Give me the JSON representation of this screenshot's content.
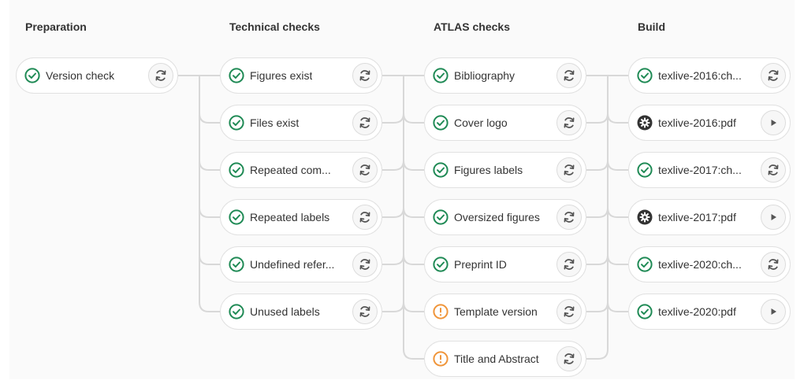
{
  "colors": {
    "success": "#1f8a55",
    "warning": "#f0953a",
    "manual": "#333333"
  },
  "stages": [
    {
      "title": "Preparation",
      "jobs": [
        {
          "name": "Version check",
          "status": "success",
          "action": "retry"
        }
      ]
    },
    {
      "title": "Technical checks",
      "jobs": [
        {
          "name": "Figures exist",
          "status": "success",
          "action": "retry"
        },
        {
          "name": "Files exist",
          "status": "success",
          "action": "retry"
        },
        {
          "name": "Repeated com...",
          "status": "success",
          "action": "retry"
        },
        {
          "name": "Repeated labels",
          "status": "success",
          "action": "retry"
        },
        {
          "name": "Undefined refer...",
          "status": "success",
          "action": "retry"
        },
        {
          "name": "Unused labels",
          "status": "success",
          "action": "retry"
        }
      ]
    },
    {
      "title": "ATLAS checks",
      "jobs": [
        {
          "name": "Bibliography",
          "status": "success",
          "action": "retry"
        },
        {
          "name": "Cover logo",
          "status": "success",
          "action": "retry"
        },
        {
          "name": "Figures labels",
          "status": "success",
          "action": "retry"
        },
        {
          "name": "Oversized figures",
          "status": "success",
          "action": "retry"
        },
        {
          "name": "Preprint ID",
          "status": "success",
          "action": "retry"
        },
        {
          "name": "Template version",
          "status": "warning",
          "action": "retry"
        },
        {
          "name": "Title and Abstract",
          "status": "warning",
          "action": "retry"
        }
      ]
    },
    {
      "title": "Build",
      "jobs": [
        {
          "name": "texlive-2016:ch...",
          "status": "success",
          "action": "retry"
        },
        {
          "name": "texlive-2016:pdf",
          "status": "manual",
          "action": "play"
        },
        {
          "name": "texlive-2017:ch...",
          "status": "success",
          "action": "retry"
        },
        {
          "name": "texlive-2017:pdf",
          "status": "manual",
          "action": "play"
        },
        {
          "name": "texlive-2020:ch...",
          "status": "success",
          "action": "retry"
        },
        {
          "name": "texlive-2020:pdf",
          "status": "success",
          "action": "play"
        }
      ]
    }
  ]
}
